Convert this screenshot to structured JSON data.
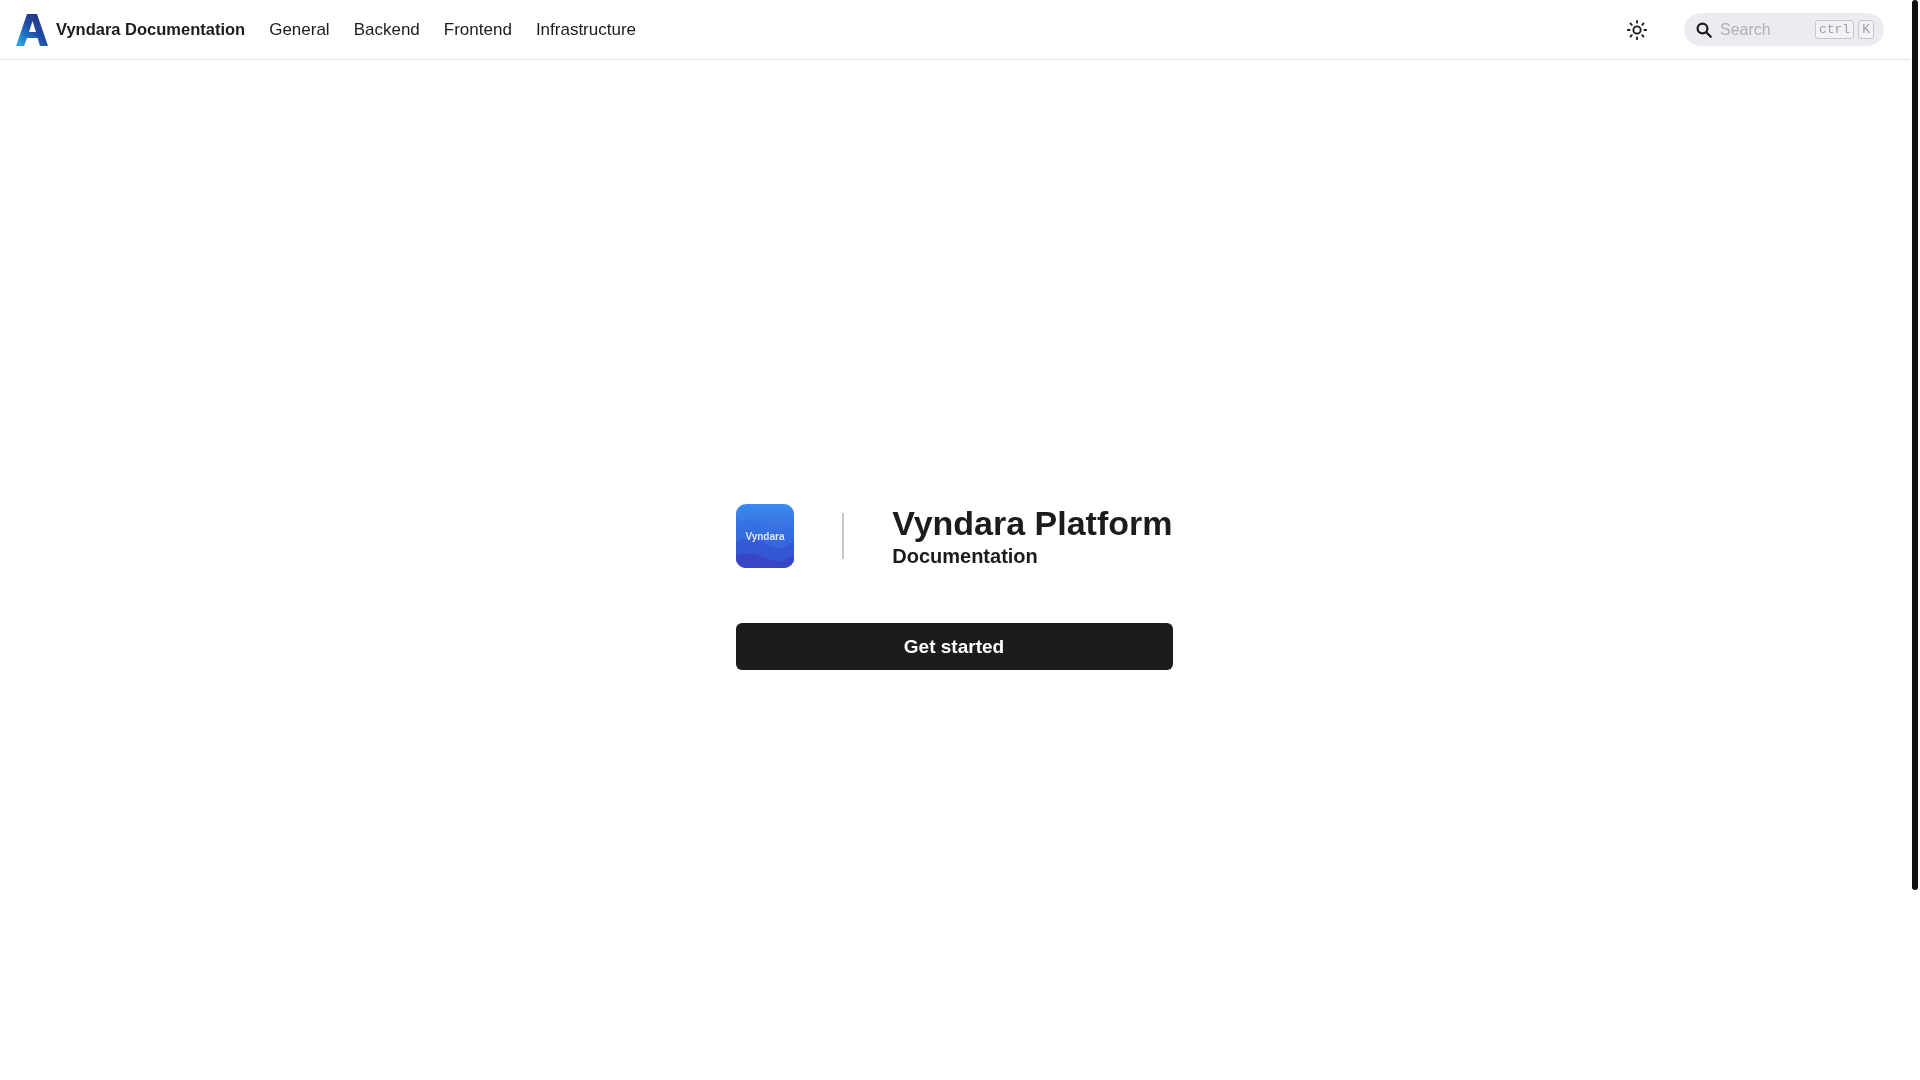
{
  "header": {
    "site_title": "Vyndara Documentation",
    "nav": [
      {
        "label": "General"
      },
      {
        "label": "Backend"
      },
      {
        "label": "Frontend"
      },
      {
        "label": "Infrastructure"
      }
    ],
    "search": {
      "placeholder": "Search",
      "shortcut": [
        "ctrl",
        "K"
      ]
    }
  },
  "hero": {
    "app_icon_text": "Vyndara",
    "title": "Vyndara Platform",
    "subtitle": "Documentation",
    "button": "Get started"
  }
}
